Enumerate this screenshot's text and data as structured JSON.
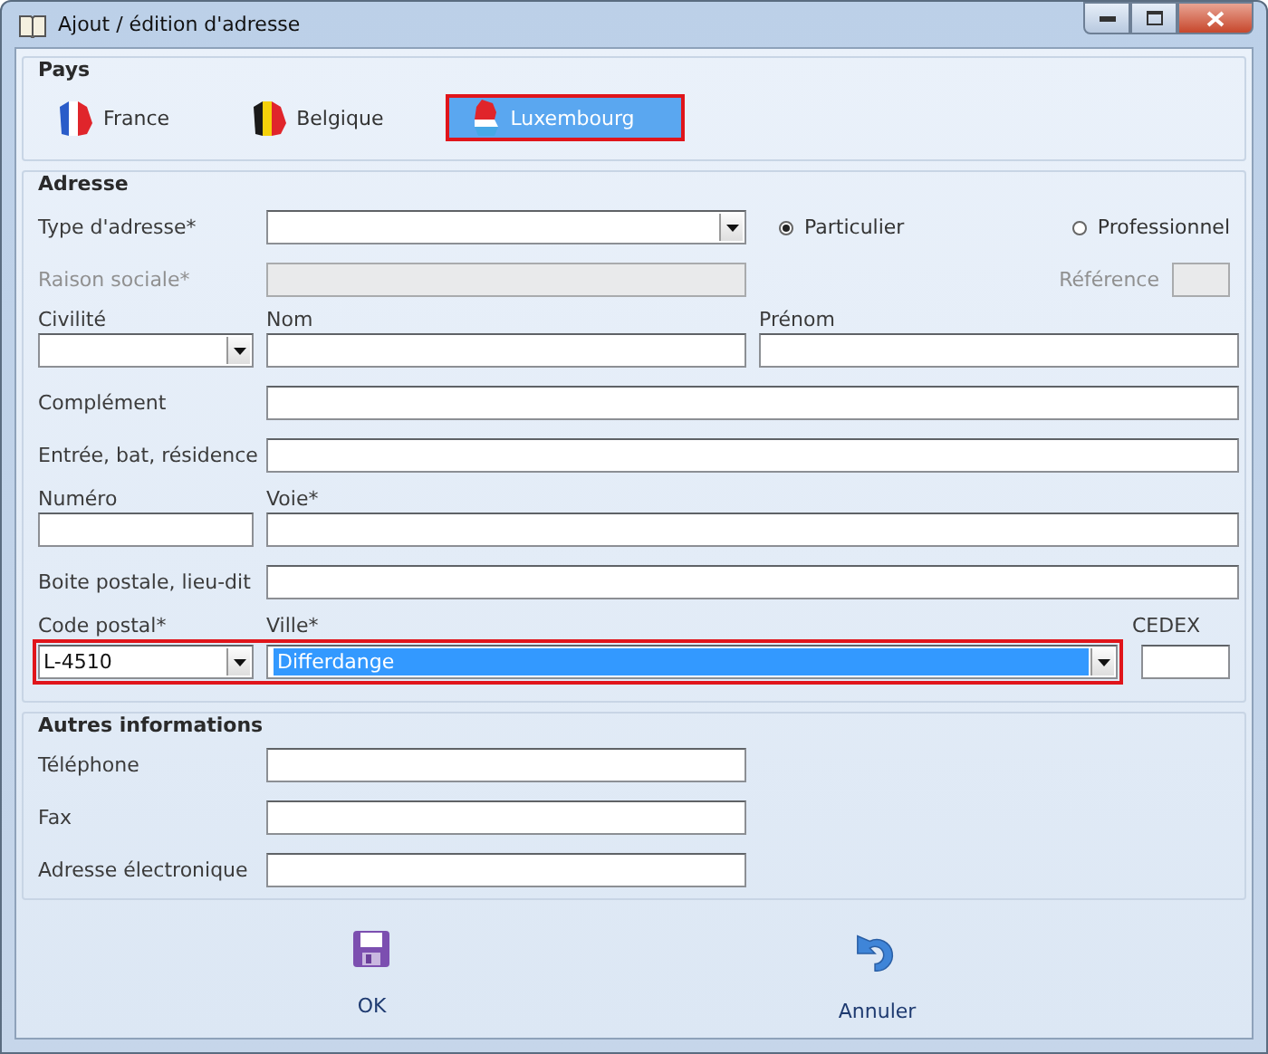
{
  "window": {
    "title": "Ajout / édition d'adresse"
  },
  "countries": {
    "legend": "Pays",
    "items": [
      {
        "label": "France",
        "kind": "france",
        "selected": false,
        "highlighted": false
      },
      {
        "label": "Belgique",
        "kind": "belgium",
        "selected": false,
        "highlighted": false
      },
      {
        "label": "Luxembourg",
        "kind": "luxembourg",
        "selected": true,
        "highlighted": true
      }
    ]
  },
  "address": {
    "legend": "Adresse",
    "address_type": {
      "label": "Type d'adresse*"
    },
    "type_options": [
      {
        "label": "Particulier",
        "selected": true
      },
      {
        "label": "Professionnel",
        "selected": false
      }
    ],
    "company": {
      "label": "Raison sociale*",
      "disabled": true
    },
    "reference": {
      "label": "Référence",
      "disabled": true
    },
    "civility": {
      "label": "Civilité"
    },
    "last_name": {
      "label": "Nom"
    },
    "first_name": {
      "label": "Prénom"
    },
    "complement": {
      "label": "Complément"
    },
    "entrance": {
      "label": "Entrée, bat, résidence"
    },
    "number": {
      "label": "Numéro"
    },
    "street": {
      "label": "Voie*"
    },
    "po_box": {
      "label": "Boite postale, lieu-dit"
    },
    "locality": {
      "highlighted": true,
      "postal_code": {
        "label": "Code postal*",
        "value": "L-4510"
      },
      "city": {
        "label": "Ville*",
        "value": "Differdange",
        "selected": true
      }
    },
    "cedex": {
      "label": "CEDEX"
    }
  },
  "other": {
    "legend": "Autres informations",
    "fields": [
      {
        "label": "Téléphone"
      },
      {
        "label": "Fax"
      },
      {
        "label": "Adresse électronique"
      }
    ]
  },
  "buttons": [
    {
      "label": "OK",
      "kind": "save"
    },
    {
      "label": "Annuler",
      "kind": "undo"
    }
  ]
}
